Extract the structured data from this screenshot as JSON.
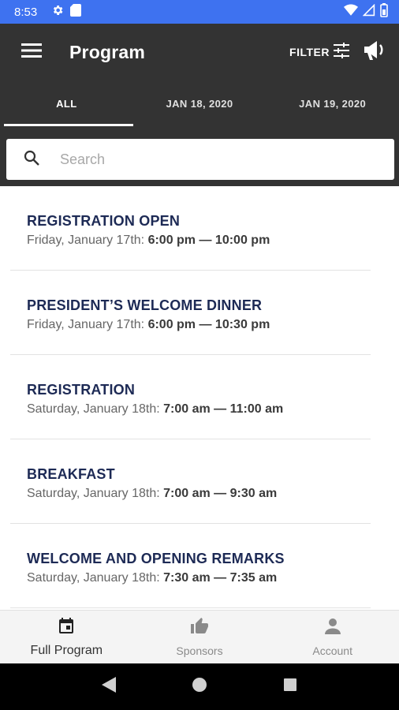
{
  "status_bar": {
    "time": "8:53",
    "icons": [
      "gear-icon",
      "sd-card-icon",
      "wifi-icon",
      "signal-icon",
      "battery-icon"
    ]
  },
  "app_bar": {
    "title": "Program",
    "filter_label": "FILTER",
    "background": "#333333"
  },
  "tabs": [
    {
      "label": "ALL",
      "active": true
    },
    {
      "label": "JAN 18, 2020",
      "active": false
    },
    {
      "label": "JAN 19, 2020",
      "active": false
    }
  ],
  "search": {
    "placeholder": "Search",
    "value": ""
  },
  "events": [
    {
      "title": "REGISTRATION OPEN",
      "date": "Friday, January 17th: ",
      "time": "6:00 pm — 10:00 pm"
    },
    {
      "title": "PRESIDENT’S WELCOME DINNER",
      "date": "Friday, January 17th: ",
      "time": "6:00 pm — 10:30 pm"
    },
    {
      "title": "REGISTRATION",
      "date": "Saturday, January 18th: ",
      "time": "7:00 am — 11:00 am"
    },
    {
      "title": "BREAKFAST",
      "date": "Saturday, January 18th: ",
      "time": "7:00 am — 9:30 am"
    },
    {
      "title": "WELCOME AND OPENING REMARKS",
      "date": "Saturday, January 18th: ",
      "time": "7:30 am — 7:35 am"
    }
  ],
  "bottom_nav": [
    {
      "label": "Full Program",
      "icon": "calendar-icon",
      "active": true
    },
    {
      "label": "Sponsors",
      "icon": "thumbs-up-icon",
      "active": false
    },
    {
      "label": "Account",
      "icon": "person-icon",
      "active": false
    }
  ],
  "colors": {
    "status_bar": "#3e72f0",
    "title_text": "#1d2a55",
    "accent": "#ffffff"
  }
}
